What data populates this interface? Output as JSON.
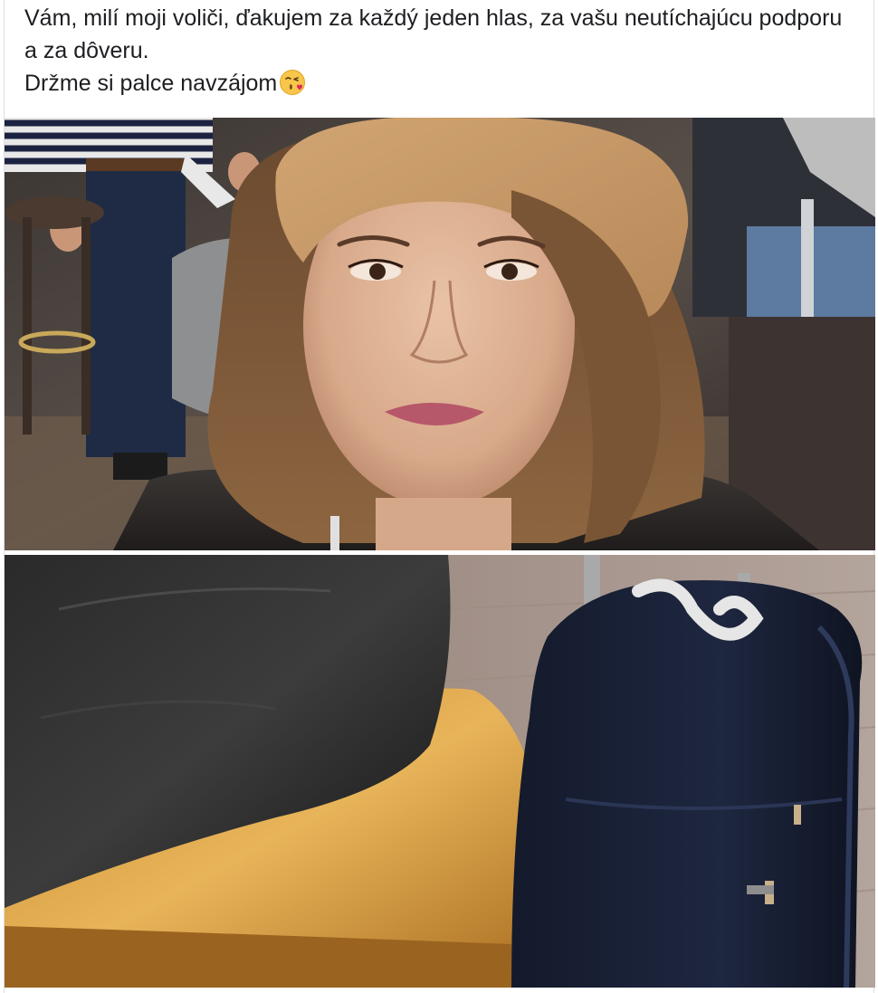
{
  "post": {
    "text_line_1": "Vám, milí moji voliči, ďakujem za každý jeden hlas, za vašu neutíchajúcu podporu a za dôveru.",
    "text_line_2": "Držme si palce navzájom",
    "emoji": "face-throwing-kiss-icon"
  },
  "photos": [
    {
      "subject": "selfie-photo"
    },
    {
      "subject": "luggage-photo"
    }
  ],
  "colors": {
    "page_bg": "#ffffff",
    "text": "#1c1e21",
    "divider": "#dddfe2"
  }
}
